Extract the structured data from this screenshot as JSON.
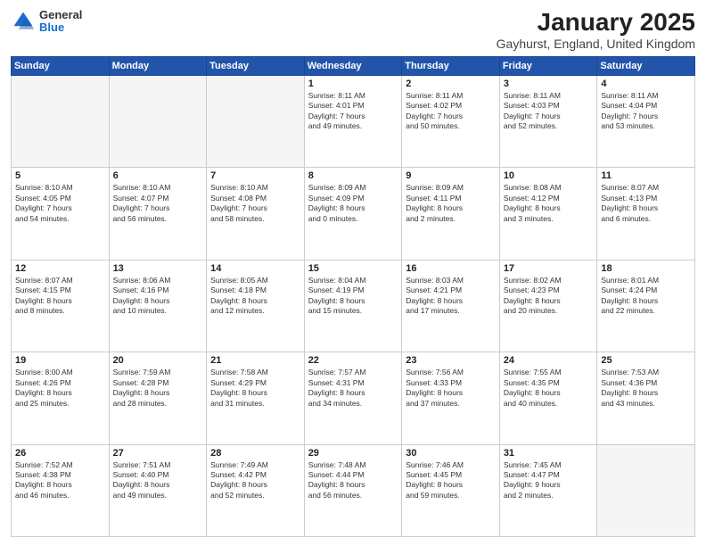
{
  "header": {
    "logo_general": "General",
    "logo_blue": "Blue",
    "title": "January 2025",
    "subtitle": "Gayhurst, England, United Kingdom"
  },
  "days_of_week": [
    "Sunday",
    "Monday",
    "Tuesday",
    "Wednesday",
    "Thursday",
    "Friday",
    "Saturday"
  ],
  "weeks": [
    [
      {
        "day": "",
        "info": ""
      },
      {
        "day": "",
        "info": ""
      },
      {
        "day": "",
        "info": ""
      },
      {
        "day": "1",
        "info": "Sunrise: 8:11 AM\nSunset: 4:01 PM\nDaylight: 7 hours\nand 49 minutes."
      },
      {
        "day": "2",
        "info": "Sunrise: 8:11 AM\nSunset: 4:02 PM\nDaylight: 7 hours\nand 50 minutes."
      },
      {
        "day": "3",
        "info": "Sunrise: 8:11 AM\nSunset: 4:03 PM\nDaylight: 7 hours\nand 52 minutes."
      },
      {
        "day": "4",
        "info": "Sunrise: 8:11 AM\nSunset: 4:04 PM\nDaylight: 7 hours\nand 53 minutes."
      }
    ],
    [
      {
        "day": "5",
        "info": "Sunrise: 8:10 AM\nSunset: 4:05 PM\nDaylight: 7 hours\nand 54 minutes."
      },
      {
        "day": "6",
        "info": "Sunrise: 8:10 AM\nSunset: 4:07 PM\nDaylight: 7 hours\nand 56 minutes."
      },
      {
        "day": "7",
        "info": "Sunrise: 8:10 AM\nSunset: 4:08 PM\nDaylight: 7 hours\nand 58 minutes."
      },
      {
        "day": "8",
        "info": "Sunrise: 8:09 AM\nSunset: 4:09 PM\nDaylight: 8 hours\nand 0 minutes."
      },
      {
        "day": "9",
        "info": "Sunrise: 8:09 AM\nSunset: 4:11 PM\nDaylight: 8 hours\nand 2 minutes."
      },
      {
        "day": "10",
        "info": "Sunrise: 8:08 AM\nSunset: 4:12 PM\nDaylight: 8 hours\nand 3 minutes."
      },
      {
        "day": "11",
        "info": "Sunrise: 8:07 AM\nSunset: 4:13 PM\nDaylight: 8 hours\nand 6 minutes."
      }
    ],
    [
      {
        "day": "12",
        "info": "Sunrise: 8:07 AM\nSunset: 4:15 PM\nDaylight: 8 hours\nand 8 minutes."
      },
      {
        "day": "13",
        "info": "Sunrise: 8:06 AM\nSunset: 4:16 PM\nDaylight: 8 hours\nand 10 minutes."
      },
      {
        "day": "14",
        "info": "Sunrise: 8:05 AM\nSunset: 4:18 PM\nDaylight: 8 hours\nand 12 minutes."
      },
      {
        "day": "15",
        "info": "Sunrise: 8:04 AM\nSunset: 4:19 PM\nDaylight: 8 hours\nand 15 minutes."
      },
      {
        "day": "16",
        "info": "Sunrise: 8:03 AM\nSunset: 4:21 PM\nDaylight: 8 hours\nand 17 minutes."
      },
      {
        "day": "17",
        "info": "Sunrise: 8:02 AM\nSunset: 4:23 PM\nDaylight: 8 hours\nand 20 minutes."
      },
      {
        "day": "18",
        "info": "Sunrise: 8:01 AM\nSunset: 4:24 PM\nDaylight: 8 hours\nand 22 minutes."
      }
    ],
    [
      {
        "day": "19",
        "info": "Sunrise: 8:00 AM\nSunset: 4:26 PM\nDaylight: 8 hours\nand 25 minutes."
      },
      {
        "day": "20",
        "info": "Sunrise: 7:59 AM\nSunset: 4:28 PM\nDaylight: 8 hours\nand 28 minutes."
      },
      {
        "day": "21",
        "info": "Sunrise: 7:58 AM\nSunset: 4:29 PM\nDaylight: 8 hours\nand 31 minutes."
      },
      {
        "day": "22",
        "info": "Sunrise: 7:57 AM\nSunset: 4:31 PM\nDaylight: 8 hours\nand 34 minutes."
      },
      {
        "day": "23",
        "info": "Sunrise: 7:56 AM\nSunset: 4:33 PM\nDaylight: 8 hours\nand 37 minutes."
      },
      {
        "day": "24",
        "info": "Sunrise: 7:55 AM\nSunset: 4:35 PM\nDaylight: 8 hours\nand 40 minutes."
      },
      {
        "day": "25",
        "info": "Sunrise: 7:53 AM\nSunset: 4:36 PM\nDaylight: 8 hours\nand 43 minutes."
      }
    ],
    [
      {
        "day": "26",
        "info": "Sunrise: 7:52 AM\nSunset: 4:38 PM\nDaylight: 8 hours\nand 46 minutes."
      },
      {
        "day": "27",
        "info": "Sunrise: 7:51 AM\nSunset: 4:40 PM\nDaylight: 8 hours\nand 49 minutes."
      },
      {
        "day": "28",
        "info": "Sunrise: 7:49 AM\nSunset: 4:42 PM\nDaylight: 8 hours\nand 52 minutes."
      },
      {
        "day": "29",
        "info": "Sunrise: 7:48 AM\nSunset: 4:44 PM\nDaylight: 8 hours\nand 56 minutes."
      },
      {
        "day": "30",
        "info": "Sunrise: 7:46 AM\nSunset: 4:45 PM\nDaylight: 8 hours\nand 59 minutes."
      },
      {
        "day": "31",
        "info": "Sunrise: 7:45 AM\nSunset: 4:47 PM\nDaylight: 9 hours\nand 2 minutes."
      },
      {
        "day": "",
        "info": ""
      }
    ]
  ]
}
